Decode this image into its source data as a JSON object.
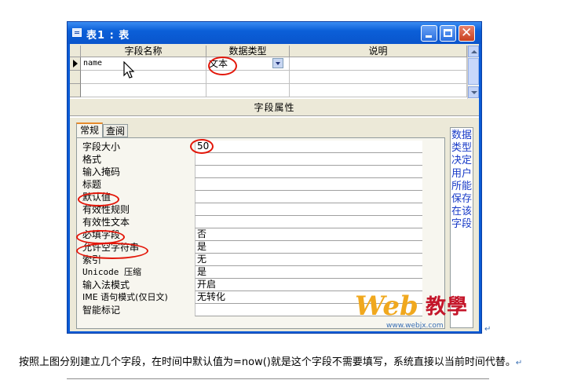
{
  "window": {
    "title": "表1 : 表"
  },
  "grid": {
    "columns": [
      "字段名称",
      "数据类型",
      "说明"
    ],
    "rows": [
      {
        "name": "name",
        "type": "文本",
        "desc": ""
      }
    ]
  },
  "properties": {
    "section_title": "字段属性",
    "tabs": [
      "常规",
      "查阅"
    ],
    "items": [
      {
        "label": "字段大小",
        "value": "50"
      },
      {
        "label": "格式",
        "value": ""
      },
      {
        "label": "输入掩码",
        "value": ""
      },
      {
        "label": "标题",
        "value": ""
      },
      {
        "label": "默认值",
        "value": ""
      },
      {
        "label": "有效性规则",
        "value": ""
      },
      {
        "label": "有效性文本",
        "value": ""
      },
      {
        "label": "必填字段",
        "value": "否"
      },
      {
        "label": "允许空字符串",
        "value": "是"
      },
      {
        "label": "索引",
        "value": "无"
      },
      {
        "label": "Unicode 压缩",
        "value": "是"
      },
      {
        "label": "输入法模式",
        "value": "开启"
      },
      {
        "label": "IME 语句模式(仅日文)",
        "value": "无转化"
      },
      {
        "label": "智能标记",
        "value": ""
      }
    ],
    "hint": "数据类型决定用户所能保存在该字段"
  },
  "watermark": {
    "letters": "Web",
    "chinese": "教學",
    "url": "www.webjx.com"
  },
  "caption": "按照上图分别建立几个字段，在时间中默认值为=now()就是这个字段不需要填写，系统直接以当前时间代替。",
  "colors": {
    "title_bar": "#0a5bd6",
    "annotation_red": "#e3170a",
    "hint_text": "#1a3cc8"
  }
}
